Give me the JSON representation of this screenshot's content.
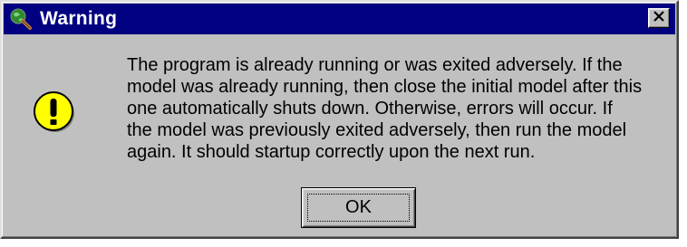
{
  "window": {
    "title": "Warning",
    "title_bar_color": "#000080",
    "icons": {
      "app": "globe-magnifier-icon",
      "close": "close-icon",
      "message": "exclamation-icon"
    }
  },
  "message": {
    "text": "The program is already running or was exited adversely.  If the\nmodel was already running, then close the initial model after this\none automatically shuts down.  Otherwise, errors will occur.  If\nthe model was previously exited adversely, then run the model\nagain.  It should startup correctly upon the next run."
  },
  "buttons": {
    "ok_label": "OK"
  },
  "colors": {
    "dialog_face": "#c0c0c0",
    "warning_fill": "#ffff00"
  }
}
